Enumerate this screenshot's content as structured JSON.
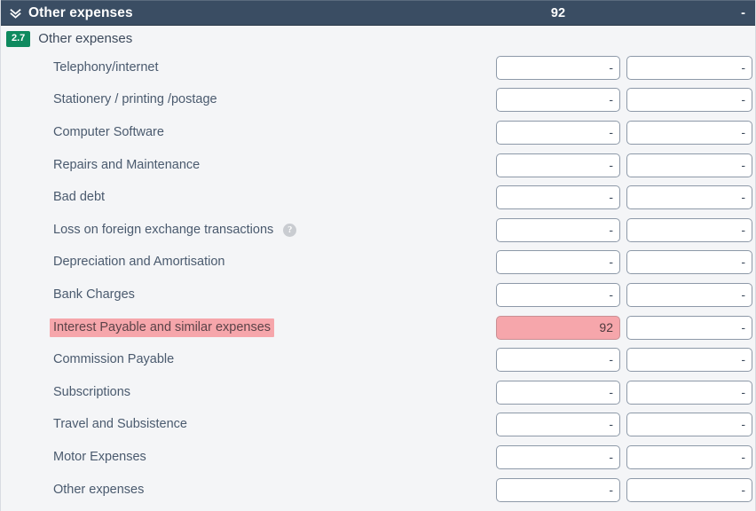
{
  "section": {
    "collapse_icon": "double-chevron-down-icon",
    "title": "Other expenses",
    "total_value": "92",
    "secondary_value": "-"
  },
  "subsection": {
    "code": "2.7",
    "label": "Other expenses"
  },
  "colors": {
    "header_bg": "#3a4d63",
    "page_bg": "#f4f5f7",
    "badge_green": "#0f8a5f",
    "highlight_pink": "#f6a6ab",
    "label_text": "#4a5a6e",
    "field_border": "#8d99a8"
  },
  "empty_value": "-",
  "rows": [
    {
      "label": "Telephony/internet",
      "help": false,
      "highlighted": false,
      "col1": "-",
      "col2": "-"
    },
    {
      "label": "Stationery / printing /postage",
      "help": false,
      "highlighted": false,
      "col1": "-",
      "col2": "-"
    },
    {
      "label": "Computer Software",
      "help": false,
      "highlighted": false,
      "col1": "-",
      "col2": "-"
    },
    {
      "label": "Repairs and Maintenance",
      "help": false,
      "highlighted": false,
      "col1": "-",
      "col2": "-"
    },
    {
      "label": "Bad debt",
      "help": false,
      "highlighted": false,
      "col1": "-",
      "col2": "-"
    },
    {
      "label": "Loss on foreign exchange transactions",
      "help": true,
      "highlighted": false,
      "col1": "-",
      "col2": "-"
    },
    {
      "label": "Depreciation and Amortisation",
      "help": false,
      "highlighted": false,
      "col1": "-",
      "col2": "-"
    },
    {
      "label": "Bank Charges",
      "help": false,
      "highlighted": false,
      "col1": "-",
      "col2": "-"
    },
    {
      "label": "Interest Payable and similar expenses",
      "help": false,
      "highlighted": true,
      "col1": "92",
      "col2": "-"
    },
    {
      "label": "Commission Payable",
      "help": false,
      "highlighted": false,
      "col1": "-",
      "col2": "-"
    },
    {
      "label": "Subscriptions",
      "help": false,
      "highlighted": false,
      "col1": "-",
      "col2": "-"
    },
    {
      "label": "Travel and Subsistence",
      "help": false,
      "highlighted": false,
      "col1": "-",
      "col2": "-"
    },
    {
      "label": "Motor Expenses",
      "help": false,
      "highlighted": false,
      "col1": "-",
      "col2": "-"
    },
    {
      "label": "Other expenses",
      "help": false,
      "highlighted": false,
      "col1": "-",
      "col2": "-"
    }
  ],
  "help_icon_glyph": "?"
}
